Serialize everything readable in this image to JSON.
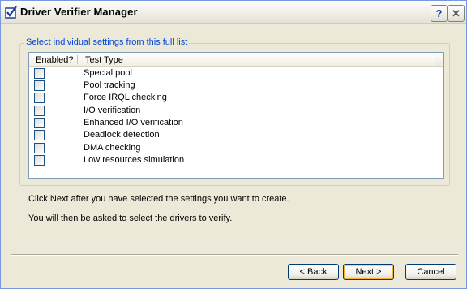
{
  "window": {
    "title": "Driver Verifier Manager",
    "help_label": "?",
    "close_label": "✕"
  },
  "group": {
    "legend": "Select individual settings from this full list"
  },
  "list": {
    "columns": [
      "Enabled?",
      "Test Type"
    ],
    "rows": [
      {
        "label": "Special pool",
        "enabled": false
      },
      {
        "label": "Pool tracking",
        "enabled": false
      },
      {
        "label": "Force IRQL checking",
        "enabled": false
      },
      {
        "label": "I/O verification",
        "enabled": false
      },
      {
        "label": "Enhanced I/O verification",
        "enabled": false
      },
      {
        "label": "Deadlock detection",
        "enabled": false
      },
      {
        "label": "DMA checking",
        "enabled": false
      },
      {
        "label": "Low resources simulation",
        "enabled": false
      }
    ]
  },
  "info": {
    "line1": "Click Next after you have selected the settings you want to create.",
    "line2": "You will then be asked to select the drivers to verify."
  },
  "buttons": {
    "back": "< Back",
    "next": "Next >",
    "cancel": "Cancel"
  }
}
